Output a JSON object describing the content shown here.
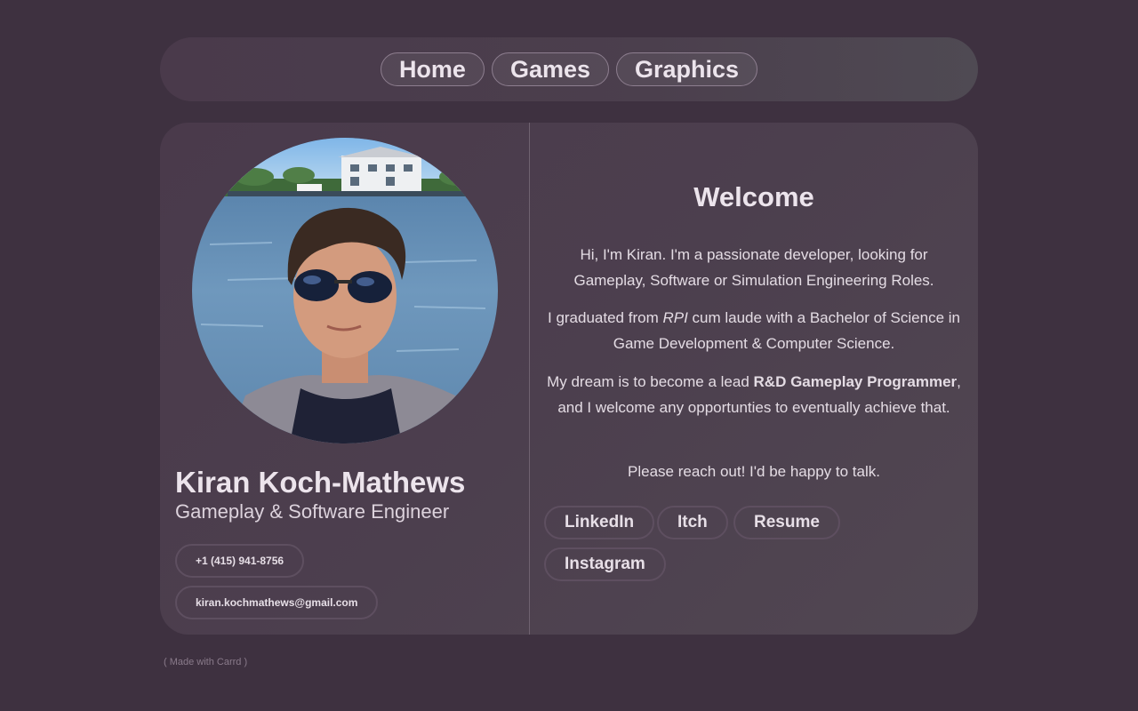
{
  "nav": {
    "items": [
      {
        "label": "Home"
      },
      {
        "label": "Games"
      },
      {
        "label": "Graphics"
      }
    ]
  },
  "profile": {
    "name": "Kiran Koch-Mathews",
    "role": "Gameplay & Software Engineer",
    "phone": "+1 (415) 941-8756",
    "email": "kiran.kochmathews@gmail.com"
  },
  "welcome": {
    "title": "Welcome",
    "p1": "Hi, I'm Kiran. I'm a passionate developer, looking for Gameplay, Software or Simulation Engineering Roles.",
    "p2": {
      "before": "I graduated from ",
      "italic": "RPI",
      "after": " cum laude with a Bachelor of Science in Game Development & Computer Science."
    },
    "p3": {
      "before": "My dream is to become a lead ",
      "bold": "R&D Gameplay Programmer",
      "after": ", and I welcome any opportunties to eventually achieve that."
    },
    "p4": "Please reach out! I'd be happy to talk."
  },
  "links": [
    {
      "label": "LinkedIn"
    },
    {
      "label": "Itch"
    },
    {
      "label": "Resume"
    },
    {
      "label": "Instagram"
    }
  ],
  "footer": "( Made with Carrd )",
  "colors": {
    "background": "#3e3140",
    "card": "#4a3a4b",
    "text": "#ece4ec",
    "pill_border": "#5e4f60"
  }
}
